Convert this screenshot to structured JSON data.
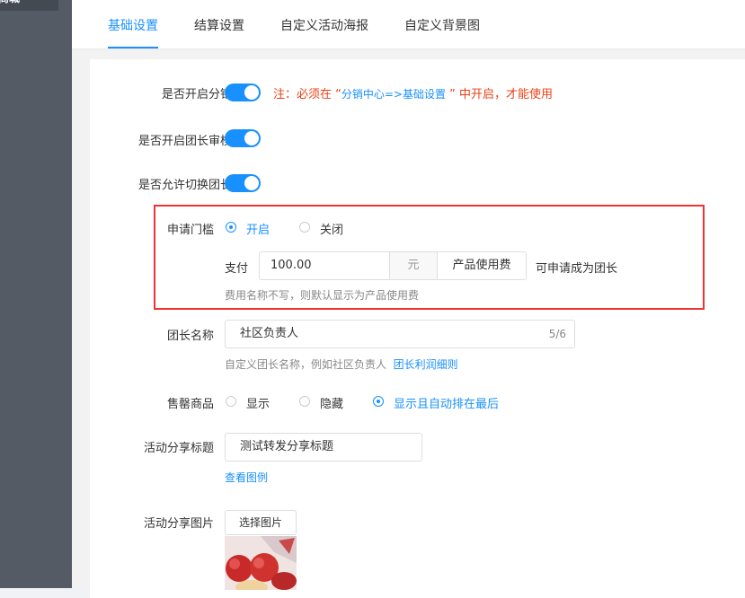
{
  "sidebar": {
    "item_label": "商城"
  },
  "tabs": [
    {
      "label": "基础设置"
    },
    {
      "label": "结算设置"
    },
    {
      "label": "自定义活动海报"
    },
    {
      "label": "自定义背景图"
    }
  ],
  "form": {
    "enable_distribution": {
      "label": "是否开启分销",
      "note_prefix": "注：必须在 “",
      "note_link": "分销中心=>基础设置",
      "note_suffix": " ” 中开启，才能使用"
    },
    "enable_leader_review": {
      "label": "是否开启团长审核"
    },
    "allow_switch_leader": {
      "label": "是否允许切换团长"
    },
    "threshold": {
      "label": "申请门槛",
      "option_on": "开启",
      "option_off": "关闭",
      "pay_label": "支付",
      "amount": "100.00",
      "unit": "元",
      "fee_name": "产品使用费",
      "suffix": "可申请成为团长",
      "hint": "费用名称不写，则默认显示为产品使用费"
    },
    "leader_name": {
      "label": "团长名称",
      "value": "社区负责人",
      "counter": "5/6",
      "hint": "自定义团长名称，例如社区负责人",
      "hint_link": "团长利润细则"
    },
    "sold_out": {
      "label": "售罄商品",
      "option_show": "显示",
      "option_hide": "隐藏",
      "option_auto": "显示且自动排在最后"
    },
    "share_title": {
      "label": "活动分享标题",
      "value": "测试转发分享标题",
      "example_link": "查看图例"
    },
    "share_image": {
      "label": "活动分享图片",
      "button": "选择图片"
    }
  }
}
